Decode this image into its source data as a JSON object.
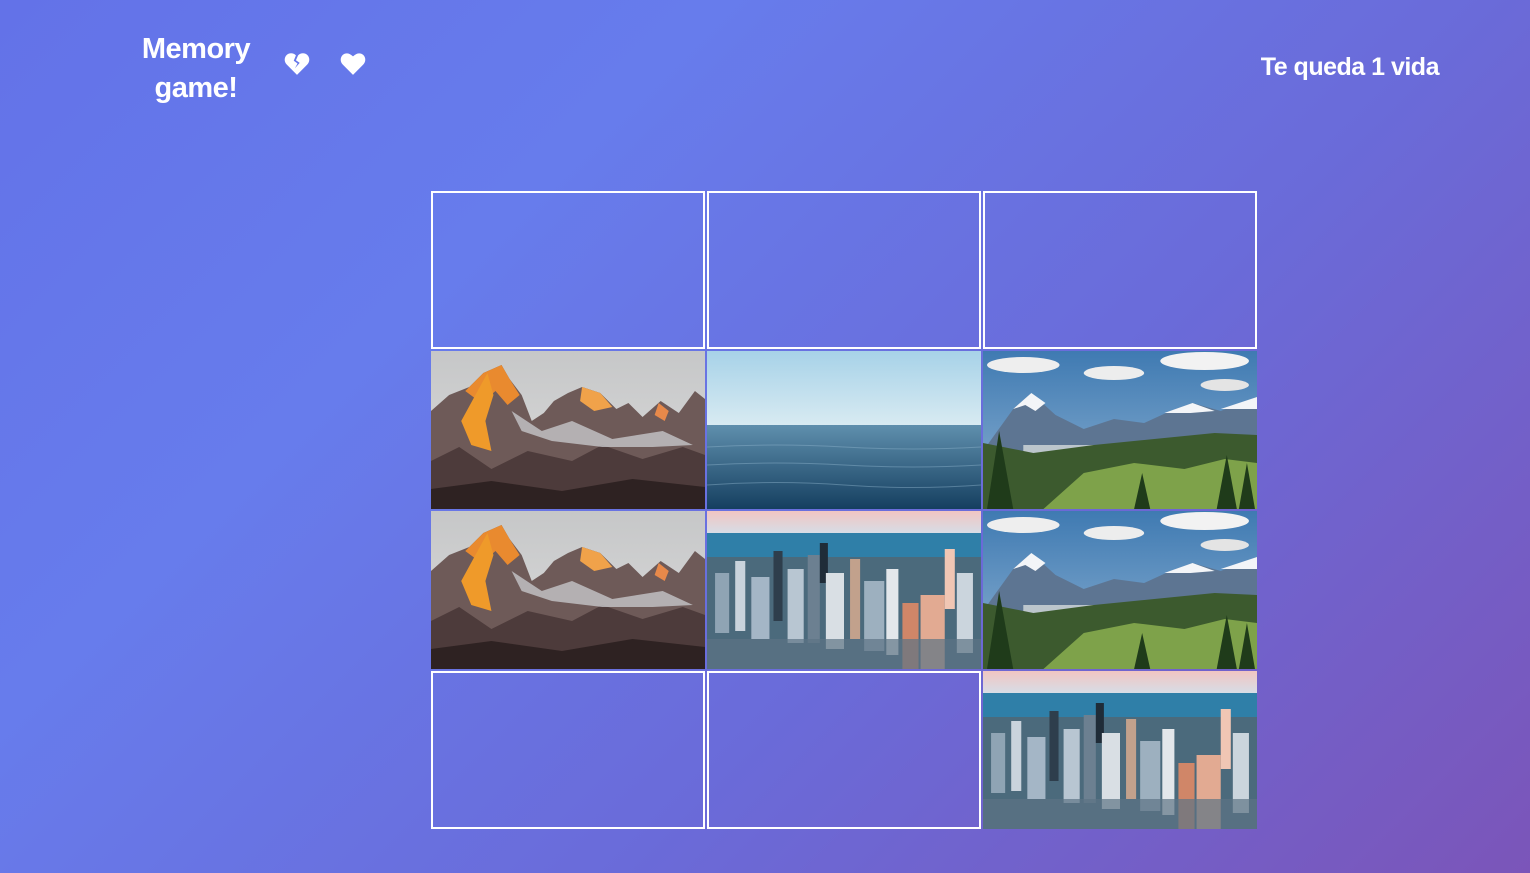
{
  "header": {
    "title": "Memory game!",
    "status": "Te queda 1 vida",
    "lives_icons": [
      "broken-heart-icon",
      "heart-icon"
    ]
  },
  "board": {
    "columns": 3,
    "rows": 4,
    "cards": [
      {
        "state": "hidden",
        "image": null
      },
      {
        "state": "hidden",
        "image": null
      },
      {
        "state": "hidden",
        "image": null
      },
      {
        "state": "revealed",
        "image": "mountain-peaks-sunset"
      },
      {
        "state": "revealed",
        "image": "calm-ocean"
      },
      {
        "state": "revealed",
        "image": "mountain-valley-forest"
      },
      {
        "state": "revealed",
        "image": "mountain-peaks-sunset"
      },
      {
        "state": "revealed",
        "image": "city-skyline-aerial"
      },
      {
        "state": "revealed",
        "image": "mountain-valley-forest"
      },
      {
        "state": "hidden",
        "image": null
      },
      {
        "state": "hidden",
        "image": null
      },
      {
        "state": "revealed",
        "image": "city-skyline-aerial"
      }
    ]
  },
  "colors": {
    "background_start": "#6372e8",
    "background_end": "#7b55b9",
    "text": "#ffffff",
    "card_border": "#ffffff"
  }
}
